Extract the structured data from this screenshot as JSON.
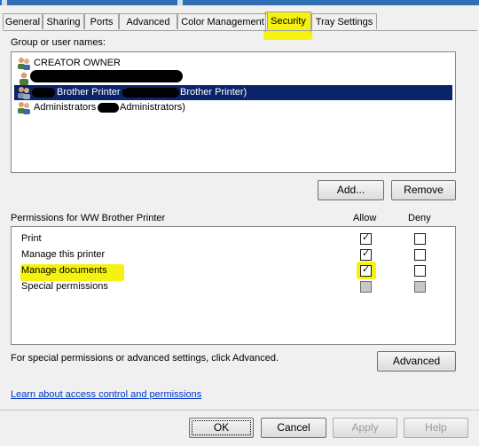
{
  "tabs": [
    {
      "label": "General"
    },
    {
      "label": "Sharing"
    },
    {
      "label": "Ports"
    },
    {
      "label": "Advanced"
    },
    {
      "label": "Color Management"
    },
    {
      "label": "Security",
      "active": true
    },
    {
      "label": "Tray Settings"
    }
  ],
  "group_users": {
    "heading": "Group or user names:",
    "items": [
      {
        "label": "CREATOR OWNER"
      },
      {
        "label": ""
      },
      {
        "label": "Brother Printer (",
        "label_suffix": "Brother Printer)",
        "selected": true
      },
      {
        "label": "Administrators",
        "label_suffix": "Administrators)"
      }
    ],
    "add_label": "Add...",
    "remove_label": "Remove"
  },
  "permissions": {
    "heading": "Permissions for WW Brother Printer",
    "allow_header": "Allow",
    "deny_header": "Deny",
    "rows": [
      {
        "label": "Print",
        "allow": true,
        "deny": false
      },
      {
        "label": "Manage this printer",
        "allow": true,
        "deny": false
      },
      {
        "label": "Manage documents",
        "allow": true,
        "deny": false
      },
      {
        "label": "Special permissions",
        "allow": false,
        "deny": false
      }
    ]
  },
  "advanced": {
    "text": "For special permissions or advanced settings, click Advanced.",
    "button_label": "Advanced"
  },
  "link_text": "Learn about access control and permissions",
  "footer": {
    "ok_label": "OK",
    "cancel_label": "Cancel",
    "apply_label": "Apply",
    "help_label": "Help"
  },
  "highlight_color": "#f4f20e",
  "selection_color": "#0a246a",
  "icons": {
    "user_group": "users-icon",
    "user": "user-icon",
    "check": "check-icon"
  }
}
